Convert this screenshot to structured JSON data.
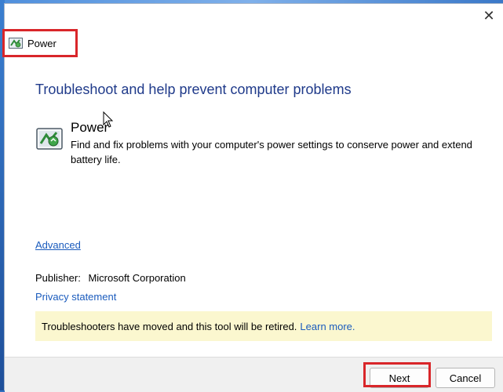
{
  "window": {
    "title": "Power",
    "close_glyph": "✕"
  },
  "main": {
    "heading": "Troubleshoot and help prevent computer problems",
    "item": {
      "title": "Power",
      "description": "Find and fix problems with your computer's power settings to conserve power and extend battery life.",
      "icon": "power-troubleshooter-icon"
    },
    "advanced_link": "Advanced",
    "publisher_label": "Publisher:",
    "publisher_value": "Microsoft Corporation",
    "privacy_link": "Privacy statement",
    "notice": {
      "text": "Troubleshooters have moved and this tool will be retired.",
      "link": "Learn more."
    }
  },
  "footer": {
    "next_label": "Next",
    "cancel_label": "Cancel"
  },
  "colors": {
    "heading": "#1f3a8a",
    "link": "#1a5bbd",
    "notice_bg": "#fbf7cf",
    "highlight": "#d9262a"
  }
}
